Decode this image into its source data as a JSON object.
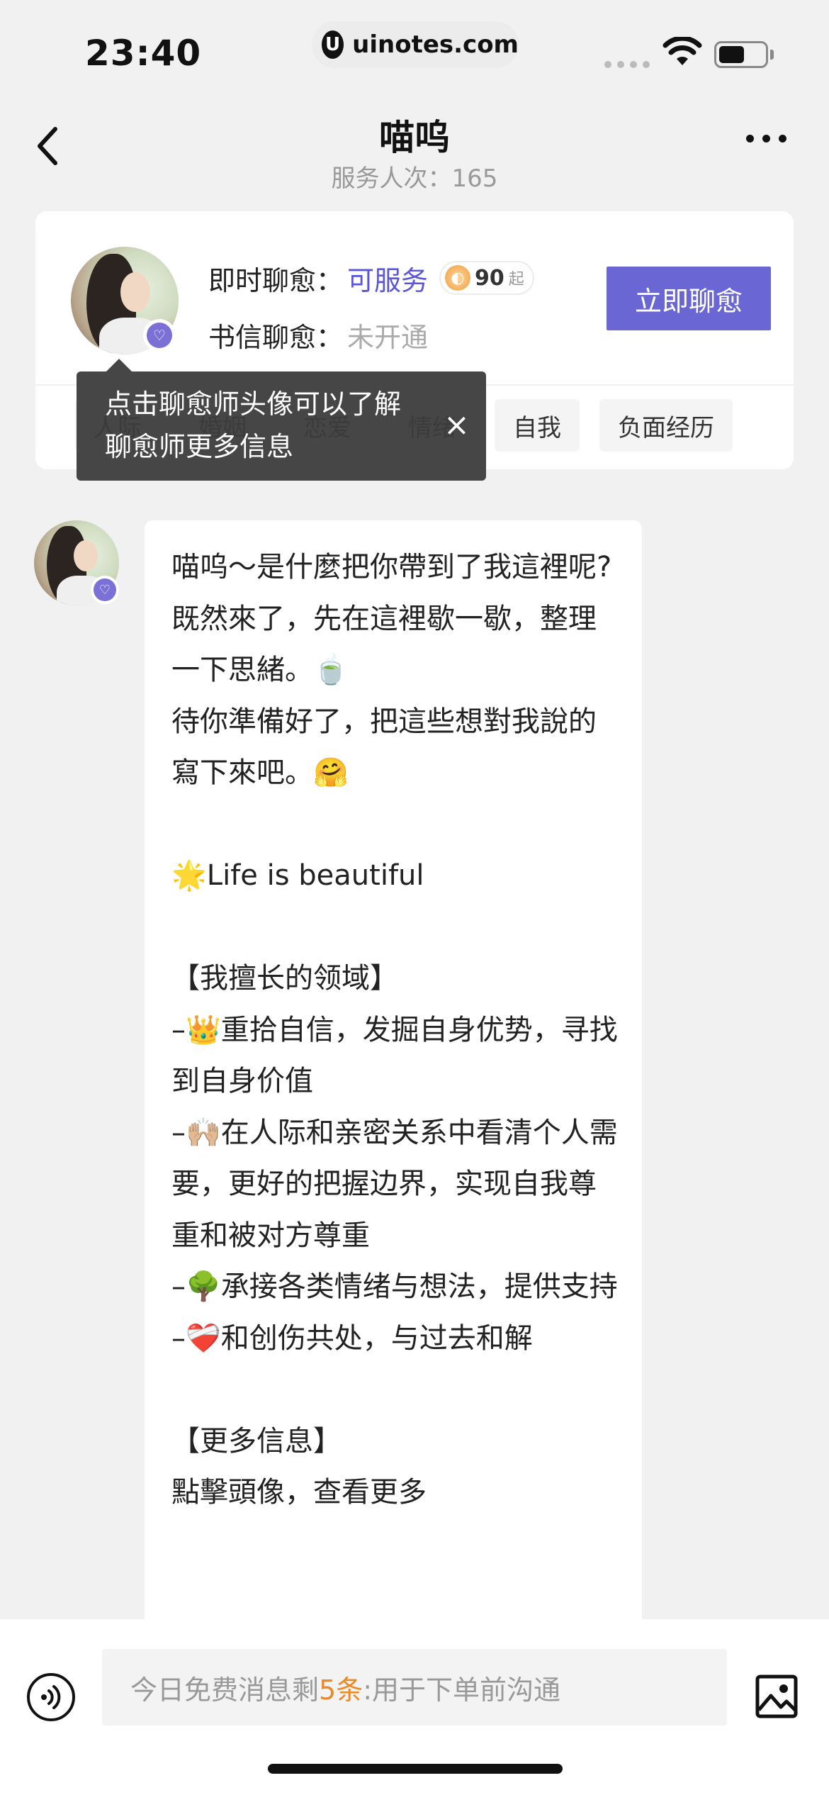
{
  "status_bar": {
    "time": "23:40",
    "url": "uinotes.com",
    "url_logo": "U",
    "battery_level": 0.55
  },
  "nav": {
    "title": "喵呜",
    "subtitle": "服务人次：165"
  },
  "card": {
    "instant_label": "即时聊愈：",
    "instant_status": "可服务",
    "price_value": "90",
    "price_unit": "起",
    "letter_label": "书信聊愈：",
    "letter_status": "未开通",
    "chat_now_label": "立即聊愈",
    "tags": [
      "人际",
      "婚姻",
      "恋爱",
      "情绪",
      "自我",
      "负面经历"
    ]
  },
  "tooltip": {
    "line1": "点击聊愈师头像可以了解",
    "line2": "聊愈师更多信息",
    "close": "×"
  },
  "message": {
    "text": "喵呜～是什麼把你帶到了我這裡呢?\n既然來了，先在這裡歇一歇，整理一下思緒。🍵\n待你準備好了，把這些想對我說的寫下來吧。🤗\n\n🌟Life is beautiful\n\n【我擅长的领域】\n–👑重拾自信，发掘自身优势，寻找到自身价值\n–🙌🏼在人际和亲密关系中看清个人需要，更好的把握边界，实现自我尊重和被对方尊重\n–🌳承接各类情绪与想法，提供支持\n–❤️‍🩹和创伤共处，与过去和解\n\n【更多信息】\n點擊頭像，查看更多"
  },
  "input_bar": {
    "prefix": "今日免费消息剩",
    "count": "5条",
    "suffix": ":用于下单前沟通"
  },
  "icons": {
    "back": "chevron-left-icon",
    "more": "more-dots-icon",
    "voice": "voice-icon",
    "image": "image-icon",
    "wifi": "wifi-icon",
    "verified": "verified-badge-icon",
    "coin": "coin-icon"
  },
  "colors": {
    "accent": "#6a66d4",
    "available": "#5b55d8",
    "highlight": "#e98a2a"
  }
}
